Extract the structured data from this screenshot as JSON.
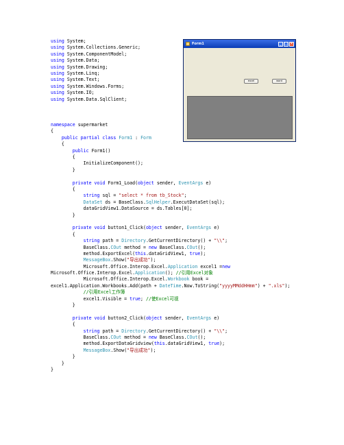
{
  "code_lines": [
    [
      {
        "t": "using",
        "c": "kw"
      },
      {
        "t": " System;"
      }
    ],
    [
      {
        "t": "using",
        "c": "kw"
      },
      {
        "t": " System.Collections.Generic;"
      }
    ],
    [
      {
        "t": "using",
        "c": "kw"
      },
      {
        "t": " System.ComponentModel;"
      }
    ],
    [
      {
        "t": "using",
        "c": "kw"
      },
      {
        "t": " System.Data;"
      }
    ],
    [
      {
        "t": "using",
        "c": "kw"
      },
      {
        "t": " System.Drawing;"
      }
    ],
    [
      {
        "t": "using",
        "c": "kw"
      },
      {
        "t": " System.Linq;"
      }
    ],
    [
      {
        "t": "using",
        "c": "kw"
      },
      {
        "t": " System.Text;"
      }
    ],
    [
      {
        "t": "using",
        "c": "kw"
      },
      {
        "t": " System.Windows.Forms;"
      }
    ],
    [
      {
        "t": "using",
        "c": "kw"
      },
      {
        "t": " System.IO;"
      }
    ],
    [
      {
        "t": "using",
        "c": "kw"
      },
      {
        "t": " System.Data.SqlClient;"
      }
    ],
    [],
    [],
    [],
    [
      {
        "t": "namespace",
        "c": "kw"
      },
      {
        "t": " supermarket"
      }
    ],
    [
      {
        "t": "{"
      }
    ],
    [
      {
        "t": "    "
      },
      {
        "t": "public partial class",
        "c": "kw"
      },
      {
        "t": " "
      },
      {
        "t": "Form1",
        "c": "ty"
      },
      {
        "t": " : "
      },
      {
        "t": "Form",
        "c": "ty"
      }
    ],
    [
      {
        "t": "    {"
      }
    ],
    [
      {
        "t": "        "
      },
      {
        "t": "public",
        "c": "kw"
      },
      {
        "t": " Form1()"
      }
    ],
    [
      {
        "t": "        {"
      }
    ],
    [
      {
        "t": "            InitializeComponent();"
      }
    ],
    [
      {
        "t": "        }"
      }
    ],
    [],
    [
      {
        "t": "        "
      },
      {
        "t": "private void",
        "c": "kw"
      },
      {
        "t": " Form1_Load("
      },
      {
        "t": "object",
        "c": "kw"
      },
      {
        "t": " sender, "
      },
      {
        "t": "EventArgs",
        "c": "ty"
      },
      {
        "t": " e)"
      }
    ],
    [
      {
        "t": "        {"
      }
    ],
    [
      {
        "t": "            "
      },
      {
        "t": "string",
        "c": "kw"
      },
      {
        "t": " sql = "
      },
      {
        "t": "\"select * from tb_Stock\"",
        "c": "st"
      },
      {
        "t": ";"
      }
    ],
    [
      {
        "t": "            "
      },
      {
        "t": "DataSet",
        "c": "ty"
      },
      {
        "t": " ds = BaseClass."
      },
      {
        "t": "SqlHelper",
        "c": "ty"
      },
      {
        "t": ".ExecutDataSet(sql);"
      }
    ],
    [
      {
        "t": "            dataGridView1.DataSource = ds.Tables[0];"
      }
    ],
    [
      {
        "t": "        }"
      }
    ],
    [],
    [
      {
        "t": "        "
      },
      {
        "t": "private void",
        "c": "kw"
      },
      {
        "t": " button1_Click("
      },
      {
        "t": "object",
        "c": "kw"
      },
      {
        "t": " sender, "
      },
      {
        "t": "EventArgs",
        "c": "ty"
      },
      {
        "t": " e)"
      }
    ],
    [
      {
        "t": "        {"
      }
    ],
    [
      {
        "t": "            "
      },
      {
        "t": "string",
        "c": "kw"
      },
      {
        "t": " path = "
      },
      {
        "t": "Directory",
        "c": "ty"
      },
      {
        "t": ".GetCurrentDirectory() + "
      },
      {
        "t": "\"\\\\\"",
        "c": "st"
      },
      {
        "t": ";"
      }
    ],
    [
      {
        "t": "            BaseClass."
      },
      {
        "t": "COut",
        "c": "ty"
      },
      {
        "t": " method = "
      },
      {
        "t": "new",
        "c": "kw"
      },
      {
        "t": " BaseClass."
      },
      {
        "t": "COut",
        "c": "ty"
      },
      {
        "t": "();"
      }
    ],
    [
      {
        "t": "            method.ExportExcel("
      },
      {
        "t": "this",
        "c": "kw"
      },
      {
        "t": ".dataGridView1, "
      },
      {
        "t": "true",
        "c": "kw"
      },
      {
        "t": ");"
      }
    ],
    [
      {
        "t": "            "
      },
      {
        "t": "MessageBox",
        "c": "ty"
      },
      {
        "t": ".Show("
      },
      {
        "t": "\"导出成功\"",
        "c": "st"
      },
      {
        "t": ");"
      }
    ],
    [
      {
        "t": "            Microsoft.Office.Interop.Excel."
      },
      {
        "t": "Application",
        "c": "ty"
      },
      {
        "t": " excel1 ="
      },
      {
        "t": "new",
        "c": "kw"
      }
    ],
    [
      {
        "t": "Microsoft.Office.Interop.Excel."
      },
      {
        "t": "Application",
        "c": "ty"
      },
      {
        "t": "(); "
      },
      {
        "t": "//引用Excel对象",
        "c": "cm"
      }
    ],
    [
      {
        "t": "            Microsoft.Office.Interop.Excel."
      },
      {
        "t": "Workbook",
        "c": "ty"
      },
      {
        "t": " book ="
      }
    ],
    [
      {
        "t": "excel1.Application.Workbooks.Add(path + "
      },
      {
        "t": "DateTime",
        "c": "ty"
      },
      {
        "t": ".Now.ToString("
      },
      {
        "t": "\"yyyyMMddHHmm\"",
        "c": "st"
      },
      {
        "t": ") + "
      },
      {
        "t": "\".xls\"",
        "c": "st"
      },
      {
        "t": ");"
      }
    ],
    [
      {
        "t": "            "
      },
      {
        "t": "//引用Excel工作簿",
        "c": "cm"
      }
    ],
    [
      {
        "t": "            excel1.Visible = "
      },
      {
        "t": "true",
        "c": "kw"
      },
      {
        "t": "; "
      },
      {
        "t": "//使Excel可视",
        "c": "cm"
      }
    ],
    [
      {
        "t": "        }"
      }
    ],
    [],
    [
      {
        "t": "        "
      },
      {
        "t": "private void",
        "c": "kw"
      },
      {
        "t": " button2_Click("
      },
      {
        "t": "object",
        "c": "kw"
      },
      {
        "t": " sender, "
      },
      {
        "t": "EventArgs",
        "c": "ty"
      },
      {
        "t": " e)"
      }
    ],
    [
      {
        "t": "        {"
      }
    ],
    [
      {
        "t": "            "
      },
      {
        "t": "string",
        "c": "kw"
      },
      {
        "t": " path = "
      },
      {
        "t": "Directory",
        "c": "ty"
      },
      {
        "t": ".GetCurrentDirectory() + "
      },
      {
        "t": "\"\\\\\"",
        "c": "st"
      },
      {
        "t": ";"
      }
    ],
    [
      {
        "t": "            BaseClass."
      },
      {
        "t": "COut",
        "c": "ty"
      },
      {
        "t": " method = "
      },
      {
        "t": "new",
        "c": "kw"
      },
      {
        "t": " BaseClass."
      },
      {
        "t": "COut",
        "c": "ty"
      },
      {
        "t": "();"
      }
    ],
    [
      {
        "t": "            method.ExportDataGridview("
      },
      {
        "t": "this",
        "c": "kw"
      },
      {
        "t": ".dataGridView1, "
      },
      {
        "t": "true",
        "c": "kw"
      },
      {
        "t": ");"
      }
    ],
    [
      {
        "t": "            "
      },
      {
        "t": "MessageBox",
        "c": "ty"
      },
      {
        "t": ".Show("
      },
      {
        "t": "\"导出成功\"",
        "c": "st"
      },
      {
        "t": ");"
      }
    ],
    [
      {
        "t": "        }"
      }
    ],
    [
      {
        "t": "    }"
      }
    ],
    [
      {
        "t": "}"
      }
    ]
  ],
  "form_window": {
    "title": "Form1",
    "button1_label": "excel",
    "button2_label": "word"
  },
  "colors": {
    "keyword": "#0000ff",
    "type": "#2b91af",
    "string": "#a31515",
    "comment": "#008000"
  }
}
